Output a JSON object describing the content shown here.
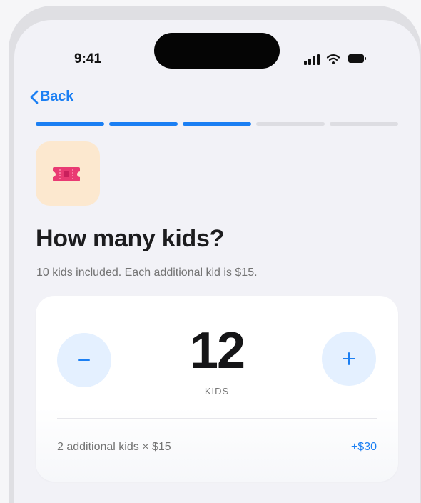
{
  "status_bar": {
    "time": "9:41"
  },
  "navigation": {
    "back_label": "Back"
  },
  "progress": {
    "steps_total": 5,
    "steps_completed": 3
  },
  "icons": {
    "hero": "ticket-icon",
    "back": "chevron-left-icon",
    "minus": "minus-icon",
    "plus": "plus-icon"
  },
  "content": {
    "title": "How many kids?",
    "subtitle": "10 kids included. Each additional kid is $15."
  },
  "counter": {
    "value": "12",
    "unit_label": "KIDS"
  },
  "fee": {
    "description": "2 additional kids × $15",
    "amount": "+$30"
  },
  "colors": {
    "accent": "#1b7ff3",
    "ticket_tile": "#fce8cf",
    "ticket": "#e93a73",
    "stepper_bg": "#e4f0ff"
  }
}
